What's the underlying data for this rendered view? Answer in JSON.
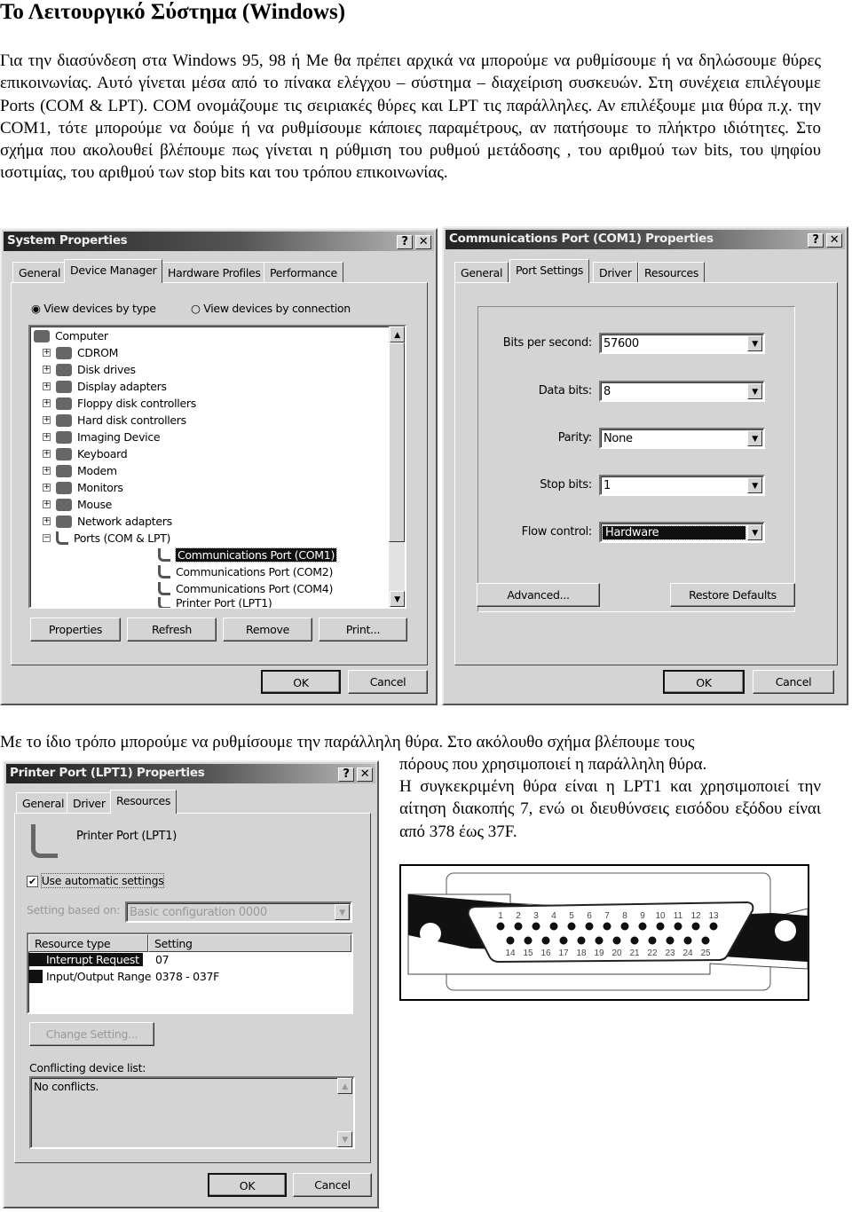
{
  "title": "Το Λειτουργικό Σύστημα (Windows)",
  "intro": "Για την διασύνδεση στα Windows 95, 98 ή Me θα πρέπει αρχικά να μπορούμε να ρυθμίσουμε ή να δηλώσουμε θύρες επικοινωνίας. Αυτό γίνεται μέσα από το πίνακα ελέγχου – σύστημα – διαχείριση συσκευών. Στη συνέχεια επιλέγουμε Ports (COM & LPT). COM ονομάζουμε τις σειριακές θύρες και LPT τις παράλληλες. Αν επιλέξουμε μια θύρα π.χ. την COM1, τότε μπορούμε να δούμε ή να ρυθμίσουμε κάποιες παραμέτρους, αν πατήσουμε το πλήκτρο ιδιότητες. Στο σχήμα που ακολουθεί βλέπουμε πως γίνεται η ρύθμιση του ρυθμού μετάδοσης , του αριθμού των bits, του ψηφίου ισοτιμίας, του αριθμού των stop bits και του τρόπου επικοινωνίας.",
  "para2_line1": "Με το ίδιο τρόπο μπορούμε να ρυθμίσουμε την παράλληλη θύρα. Στο ακόλουθο σχήμα βλέπουμε τους",
  "para2_rest": "πόρους που χρησιμοποιεί η παράλληλη θύρα.",
  "para3": "Η συγκεκριμένη θύρα είναι η LPT1 και χρησιμοποιεί την αίτηση διακοπής 7, ενώ οι διευθύνσεις εισόδου εξόδου είναι από 378 έως 37F.",
  "system_properties": {
    "title": "System Properties",
    "help": "?",
    "close": "✕",
    "tabs": [
      "General",
      "Device Manager",
      "Hardware Profiles",
      "Performance"
    ],
    "radio_by_type": "View devices by type",
    "radio_by_connection": "View devices by connection",
    "tree": [
      "Computer",
      "CDROM",
      "Disk drives",
      "Display adapters",
      "Floppy disk controllers",
      "Hard disk controllers",
      "Imaging Device",
      "Keyboard",
      "Modem",
      "Monitors",
      "Mouse",
      "Network adapters",
      "Ports (COM & LPT)",
      "Communications Port (COM1)",
      "Communications Port (COM2)",
      "Communications Port (COM4)",
      "Printer Port (LPT1)"
    ],
    "buttons": [
      "Properties",
      "Refresh",
      "Remove",
      "Print..."
    ],
    "ok": "OK",
    "cancel": "Cancel"
  },
  "com1_properties": {
    "title": "Communications Port (COM1) Properties",
    "help": "?",
    "close": "✕",
    "tabs": [
      "General",
      "Port Settings",
      "Driver",
      "Resources"
    ],
    "fields": [
      {
        "label": "Bits per second:",
        "value": "57600"
      },
      {
        "label": "Data bits:",
        "value": "8"
      },
      {
        "label": "Parity:",
        "value": "None"
      },
      {
        "label": "Stop bits:",
        "value": "1"
      },
      {
        "label": "Flow control:",
        "value": "Hardware"
      }
    ],
    "advanced": "Advanced...",
    "restore": "Restore Defaults",
    "ok": "OK",
    "cancel": "Cancel"
  },
  "lpt1_properties": {
    "title": "Printer Port (LPT1) Properties",
    "help": "?",
    "close": "✕",
    "tabs": [
      "General",
      "Driver",
      "Resources"
    ],
    "device_name": "Printer Port (LPT1)",
    "auto_settings": "Use automatic settings",
    "auto_checked": true,
    "setting_based_label": "Setting based on:",
    "setting_based_value": "Basic configuration 0000",
    "columns": [
      "Resource type",
      "Setting"
    ],
    "resources": [
      [
        "Interrupt Request",
        "07"
      ],
      [
        "Input/Output Range",
        "0378 - 037F"
      ]
    ],
    "change_setting": "Change Setting...",
    "conflict_label": "Conflicting device list:",
    "conflict_text": "No conflicts.",
    "ok": "OK",
    "cancel": "Cancel"
  },
  "connector": {
    "top_pins": [
      "1",
      "2",
      "3",
      "4",
      "5",
      "6",
      "7",
      "8",
      "9",
      "10",
      "11",
      "12",
      "13"
    ],
    "bottom_pins": [
      "14",
      "15",
      "16",
      "17",
      "18",
      "19",
      "20",
      "21",
      "22",
      "23",
      "24",
      "25"
    ]
  }
}
